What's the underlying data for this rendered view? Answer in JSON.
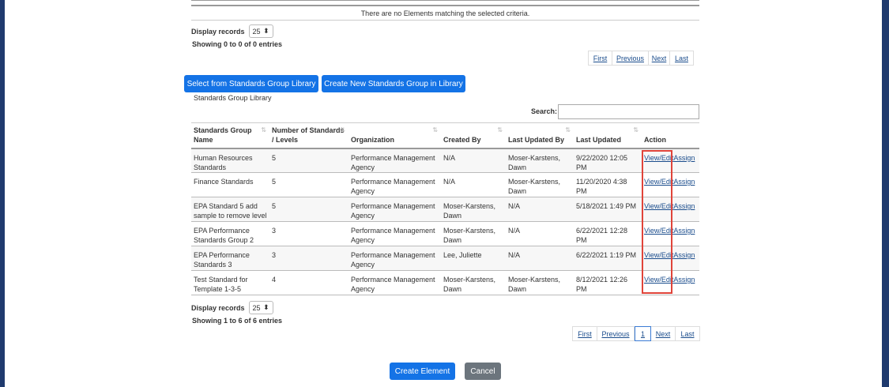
{
  "top_table": {
    "no_match_text": "There are no Elements matching the selected criteria.",
    "display_label": "Display records",
    "display_value": "25",
    "showing_text": "Showing 0 to 0 of 0 entries",
    "pager": [
      "First",
      "Previous",
      "Next",
      "Last"
    ]
  },
  "buttons": {
    "select_library": "Select from Standards Group Library",
    "create_new": "Create New Standards Group in Library",
    "create_element": "Create Element",
    "cancel": "Cancel"
  },
  "library": {
    "caption": "Standards Group Library",
    "search_label": "Search:",
    "search_value": "",
    "columns": [
      "Standards Group Name",
      "Number of Standards / Levels",
      "Organization",
      "Created By",
      "Last Updated By",
      "Last Updated",
      "Action"
    ],
    "rows": [
      {
        "name": "Human Resources Standards",
        "count": "5",
        "org": "Performance Management Agency",
        "created_by": "N/A",
        "updated_by": "Moser-Karstens, Dawn",
        "updated": "9/22/2020 12:05 PM",
        "view": "View/Edit",
        "assign": "Assign"
      },
      {
        "name": "Finance Standards",
        "count": "5",
        "org": "Performance Management Agency",
        "created_by": "N/A",
        "updated_by": "Moser-Karstens, Dawn",
        "updated": "11/20/2020 4:38 PM",
        "view": "View/Edit",
        "assign": "Assign"
      },
      {
        "name": "EPA Standard 5 add sample to remove level",
        "count": "5",
        "org": "Performance Management Agency",
        "created_by": "Moser-Karstens, Dawn",
        "updated_by": "N/A",
        "updated": "5/18/2021 1:49 PM",
        "view": "View/Edit",
        "assign": "Assign"
      },
      {
        "name": "EPA Performance Standards Group 2",
        "count": "3",
        "org": "Performance Management Agency",
        "created_by": "Moser-Karstens, Dawn",
        "updated_by": "N/A",
        "updated": "6/22/2021 12:28 PM",
        "view": "View/Edit",
        "assign": "Assign"
      },
      {
        "name": "EPA Performance Standards 3",
        "count": "3",
        "org": "Performance Management Agency",
        "created_by": "Lee, Juliette",
        "updated_by": "N/A",
        "updated": "6/22/2021 1:19 PM",
        "view": "View/Edit",
        "assign": "Assign"
      },
      {
        "name": "Test Standard for Template 1-3-5",
        "count": "4",
        "org": "Performance Management Agency",
        "created_by": "Moser-Karstens, Dawn",
        "updated_by": "Moser-Karstens, Dawn",
        "updated": "8/12/2021 12:26 PM",
        "view": "View/Edit",
        "assign": "Assign"
      }
    ],
    "display_label": "Display records",
    "display_value": "25",
    "showing_text": "Showing 1 to 6 of 6 entries",
    "pager": [
      "First",
      "Previous",
      "1",
      "Next",
      "Last"
    ]
  },
  "colors": {
    "primary": "#1473e6",
    "secondary": "#6c757d",
    "side_bar": "#1f3a6e",
    "highlight": "#e0443a",
    "link": "#1a4c8c"
  }
}
